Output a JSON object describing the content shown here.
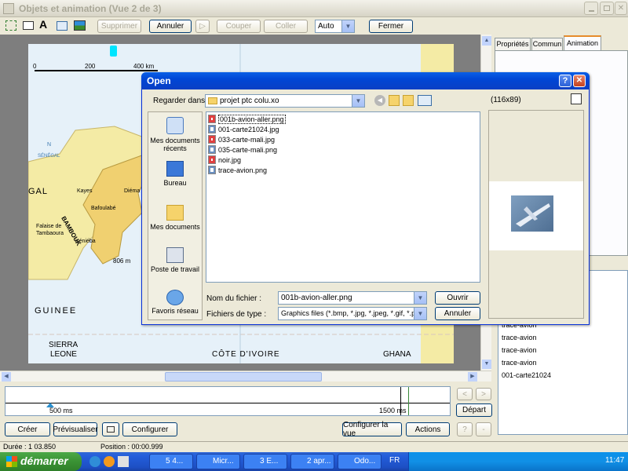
{
  "app": {
    "title": "Objets et animation  (Vue 2 de 3)",
    "toolbar": {
      "supprimer": "Supprimer",
      "annuler": "Annuler",
      "couper": "Couper",
      "coller": "Coller",
      "zoom_value": "Auto",
      "fermer": "Fermer"
    },
    "right_tabs": [
      "Propriétés",
      "Commun",
      "Animation"
    ],
    "right_list": [
      "trace-avion",
      "trace-avion",
      "trace-avion",
      "trace-avion",
      "001-carte21024"
    ],
    "map_labels": {
      "scale_0": "0",
      "scale_200": "200",
      "scale_400": "400 km",
      "nord": "N",
      "senegal": "SÉNÉGAL",
      "gal": "GAL",
      "kayes": "Kayes",
      "diema": "Diéma",
      "bafoulabe": "Bafoulabé",
      "bambouk": "BAMBOUK",
      "falaise": "Falaise de Tambaoura",
      "kenieba": "Kéniéba",
      "altitude": "806 m",
      "guinee": "GUINEE",
      "sierra": "SIERRA",
      "leone": "LEONE",
      "cote": "CÔTE D'IVOIRE",
      "ghana": "GHANA"
    },
    "timeline": {
      "mark_500": "500 ms",
      "mark_1500": "1500 ms",
      "depart": "Départ",
      "prev_arrow": "<",
      "next_arrow": ">"
    },
    "bottom_buttons": {
      "creer": "Créer",
      "previsualiser": "Prévisualiser",
      "configurer": "Configurer",
      "configurer_la_vue": "Configurer la vue",
      "actions": "Actions",
      "help": "?",
      "minus": "-"
    },
    "status": {
      "duree": "Durée : 1 03.850",
      "position": "Position : 00:00.999"
    }
  },
  "dialog": {
    "title": "Open",
    "help_btn": "?",
    "close_btn": "✕",
    "look_in_label": "Regarder dans",
    "look_in_value": "projet ptc colu.xo",
    "places": [
      {
        "label": "Mes documents récents",
        "icon": "recent-docs-icon"
      },
      {
        "label": "Bureau",
        "icon": "desktop-icon"
      },
      {
        "label": "Mes documents",
        "icon": "my-documents-icon"
      },
      {
        "label": "Poste de travail",
        "icon": "my-computer-icon"
      },
      {
        "label": "Favoris réseau",
        "icon": "network-icon"
      }
    ],
    "files": [
      {
        "name": "001b-avion-aller.png",
        "selected": true
      },
      {
        "name": "001-carte21024.jpg",
        "selected": false
      },
      {
        "name": "033-carte-mali.jpg",
        "selected": false
      },
      {
        "name": "035-carte-mali.png",
        "selected": false
      },
      {
        "name": "noir.jpg",
        "selected": false
      },
      {
        "name": "trace-avion.png",
        "selected": false
      }
    ],
    "preview_size": "(116x89)",
    "filename_label": "Nom du fichier :",
    "filename_value": "001b-avion-aller.png",
    "filetype_label": "Fichiers de type :",
    "filetype_value": "Graphics files (*.bmp, *.jpg, *.jpeg, *.gif, *.png)",
    "open_btn": "Ouvrir",
    "cancel_btn": "Annuler"
  },
  "taskbar": {
    "start": "démarrer",
    "tasks": [
      "5 4...",
      "Micr...",
      "3 E...",
      "2 apr...",
      "Odo..."
    ],
    "lang": "FR",
    "clock": "11:47"
  }
}
